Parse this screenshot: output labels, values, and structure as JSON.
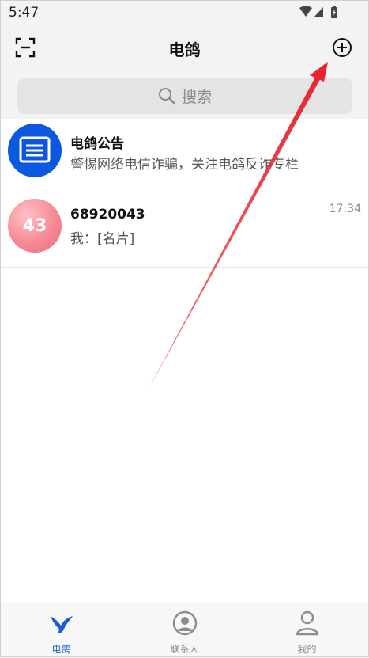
{
  "status": {
    "time": "5:47"
  },
  "header": {
    "title": "电鸽",
    "search_placeholder": "搜索"
  },
  "conversations": [
    {
      "name": "电鸽公告",
      "preview": "警惕网络电信诈骗，关注电鸽反诈专栏",
      "time": "",
      "avatar_icon": "notice-icon"
    },
    {
      "name": "68920043",
      "preview": "我：[名片]",
      "time": "17:34",
      "avatar_text": "43"
    }
  ],
  "bottom_nav": [
    {
      "label": "电鸽",
      "icon": "pigeon-icon"
    },
    {
      "label": "联系人",
      "icon": "contacts-icon"
    },
    {
      "label": "我的",
      "icon": "profile-icon"
    }
  ],
  "colors": {
    "accent": "#1a5cd6",
    "annotation": "#e8232e"
  }
}
